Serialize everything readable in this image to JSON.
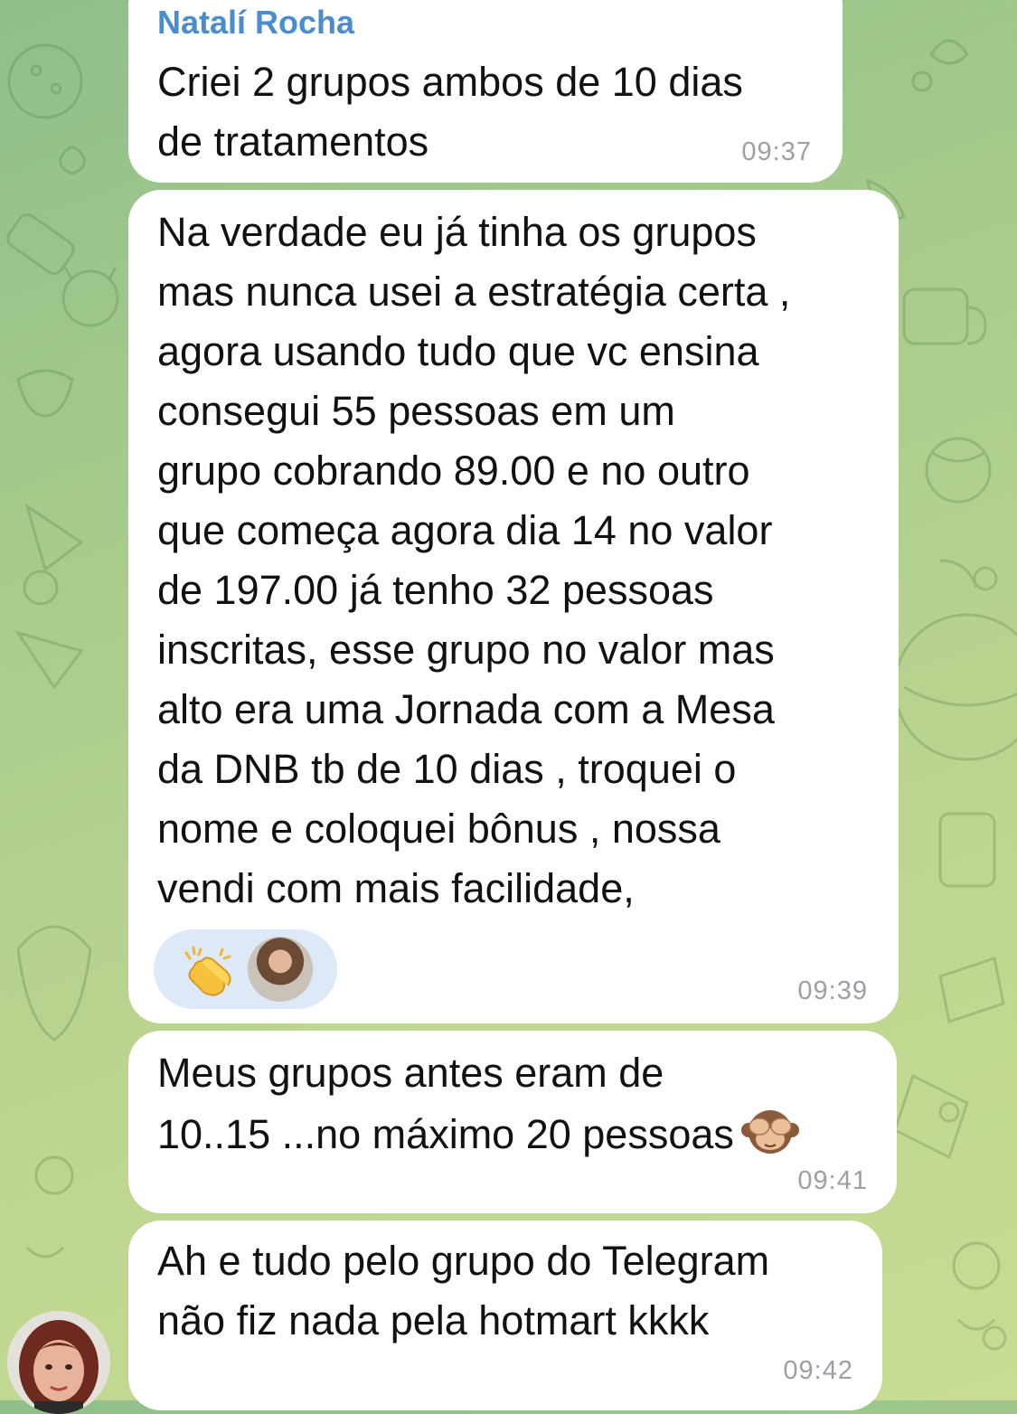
{
  "chat": {
    "sender_name": "Natalí Rocha",
    "messages": [
      {
        "text": "Criei 2 grupos ambos de 10 dias\nde tratamentos",
        "time": "09:37"
      },
      {
        "text": "Na verdade eu já tinha os grupos\nmas nunca usei a estratégia certa ,\nagora usando tudo que vc ensina\nconsegui 55 pessoas em um\ngrupo cobrando 89.00 e no outro\nque começa agora dia 14 no valor\nde 197.00 já tenho 32 pessoas\ninscritas, esse grupo no valor mas\nalto era uma Jornada com a Mesa\nda DNB tb de 10 dias , troquei o\nnome e coloquei bônus , nossa\nvendi com mais facilidade,",
        "time": "09:39",
        "reaction": {
          "emoji_icon": "clapping-hands-icon",
          "count_avatar": "reactor-avatar"
        }
      },
      {
        "text": "Meus grupos antes eram de\n10..15 ...no máximo 20 pessoas",
        "time": "09:41",
        "trailing_icon": "see-no-evil-monkey-icon"
      },
      {
        "text": "Ah e tudo pelo grupo do Telegram\nnão fiz nada pela hotmart kkkk",
        "time": "09:42"
      }
    ]
  },
  "colors": {
    "sender": "#4a8cd0",
    "bubble": "#ffffff",
    "time": "#9aa0a6",
    "reaction_bg": "#dde9f7"
  }
}
